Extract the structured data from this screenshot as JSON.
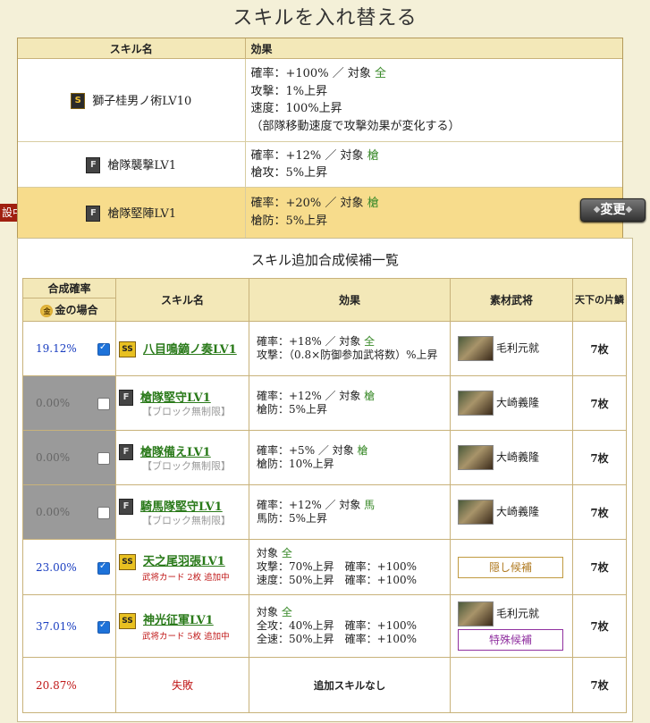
{
  "title": "スキルを入れ替える",
  "current": {
    "headers": {
      "name": "スキル名",
      "effect": "効果"
    },
    "rows": [
      {
        "badge": "S",
        "name": "獅子桂男ノ術LV10",
        "lines": [
          "確率：+100% ／ 対象 ",
          "攻撃：1%上昇",
          "速度：100%上昇",
          "（部隊移動速度で攻撃効果が変化する）"
        ],
        "target": "全"
      },
      {
        "badge": "F",
        "name": "槍隊襲撃LV1",
        "lines": [
          "確率：+12% ／ 対象 ",
          "槍攻：5%上昇"
        ],
        "target": "槍"
      },
      {
        "badge": "F",
        "name": "槍隊堅陣LV1",
        "lines": [
          "確率：+20% ／ 対象 ",
          "槍防：5%上昇"
        ],
        "target": "槍"
      }
    ],
    "change_label": "変更",
    "tag_label": "設中"
  },
  "candidates": {
    "title": "スキル追加合成候補一覧",
    "headers": {
      "rate": "合成確率",
      "gold": "金の場合",
      "name": "スキル名",
      "effect": "効果",
      "material": "素材武将",
      "count": "天下の片鱗"
    },
    "rows": [
      {
        "rate": "19.12%",
        "badge": "SS",
        "name": "八目鳴鏑ノ奏LV1",
        "e1": "確率：+18% ／ 対象 ",
        "t": "全",
        "e2": "攻撃：（0.8×防御参加武将数）%上昇",
        "mat": "毛利元就",
        "count": "7枚"
      },
      {
        "rate": "0.00%",
        "badge": "F",
        "name": "槍隊堅守LV1",
        "sub": "【ブロック無制限】",
        "e1": "確率：+12% ／ 対象 ",
        "t": "槍",
        "e2": "槍防：5%上昇",
        "mat": "大崎義隆",
        "count": "7枚"
      },
      {
        "rate": "0.00%",
        "badge": "F",
        "name": "槍隊備えLV1",
        "sub": "【ブロック無制限】",
        "e1": "確率：+5% ／ 対象 ",
        "t": "槍",
        "e2": "槍防：10%上昇",
        "mat": "大崎義隆",
        "count": "7枚"
      },
      {
        "rate": "0.00%",
        "badge": "F",
        "name": "騎馬隊堅守LV1",
        "sub": "【ブロック無制限】",
        "e1": "確率：+12% ／ 対象 ",
        "t": "馬",
        "e2": "馬防：5%上昇",
        "mat": "大崎義隆",
        "count": "7枚"
      },
      {
        "rate": "23.00%",
        "badge": "SS",
        "name": "天之尾羽張LV1",
        "sub": "武将カード 2枚 追加中",
        "e0": "対象 ",
        "t": "全",
        "e1": "攻撃：70%上昇　確率：+100%",
        "e2": "速度：50%上昇　確率：+100%",
        "box": "隠し候補",
        "count": "7枚"
      },
      {
        "rate": "37.01%",
        "badge": "SS",
        "name": "神光征軍LV1",
        "sub": "武将カード 5枚 追加中",
        "e0": "対象 ",
        "t": "全",
        "e1": "全攻：40%上昇　確率：+100%",
        "e2": "全速：50%上昇　確率：+100%",
        "mat": "毛利元就",
        "box": "特殊候補",
        "count": "7枚"
      },
      {
        "rate": "20.87%",
        "fail": "失敗",
        "none": "追加スキルなし",
        "count": "7枚"
      }
    ]
  }
}
